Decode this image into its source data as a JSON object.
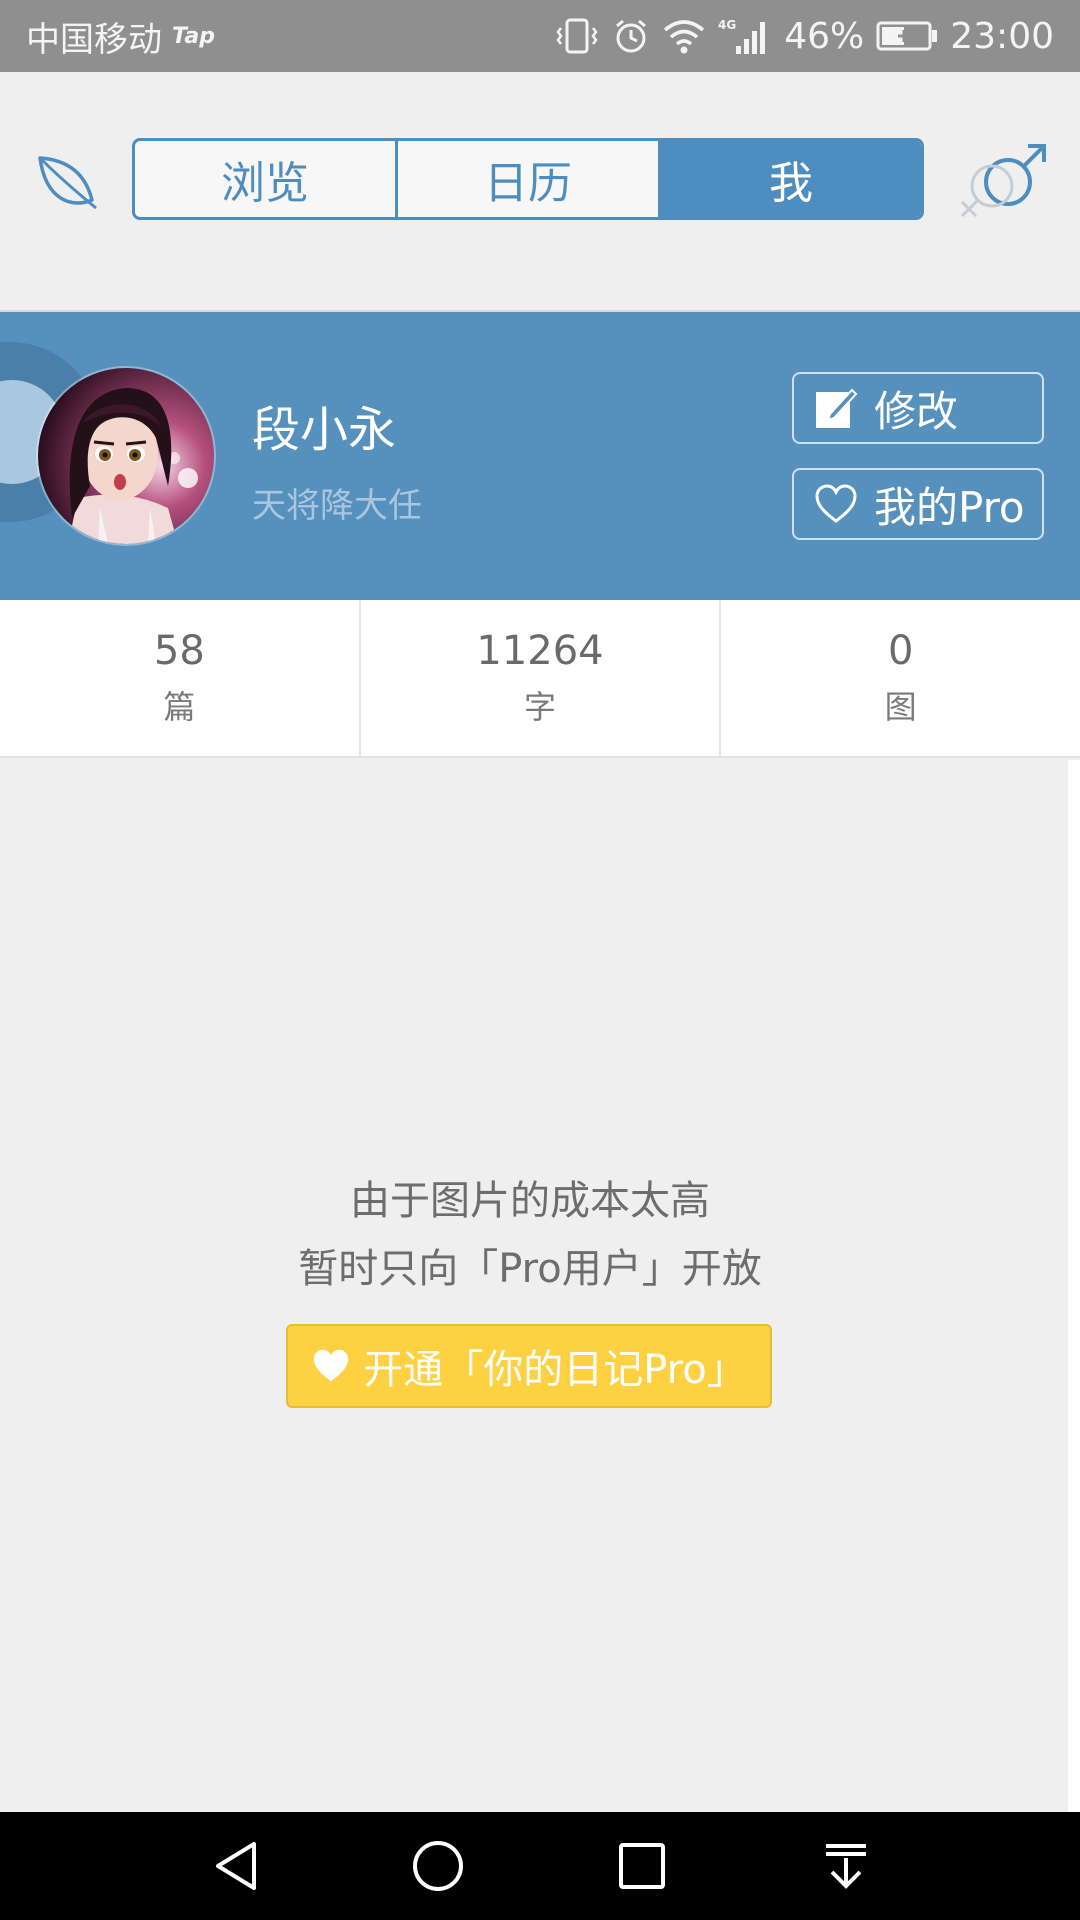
{
  "status_bar": {
    "carrier": "中国移动",
    "carrier_tag": "Tap",
    "network": "4G",
    "battery": "46%",
    "time": "23:00"
  },
  "header": {
    "tabs": [
      {
        "label": "浏览",
        "active": false
      },
      {
        "label": "日历",
        "active": false
      },
      {
        "label": "我",
        "active": true
      }
    ]
  },
  "profile": {
    "name": "段小永",
    "motto": "天将降大任",
    "edit_label": "修改",
    "pro_label": "我的Pro"
  },
  "stats": [
    {
      "value": "58",
      "label": "篇"
    },
    {
      "value": "11264",
      "label": "字"
    },
    {
      "value": "0",
      "label": "图"
    }
  ],
  "content": {
    "message_line1": "由于图片的成本太高",
    "message_line2": "暂时只向「Pro用户」开放",
    "cta_label": "开通「你的日记Pro」"
  },
  "colors": {
    "accent": "#4e8dbf",
    "profile_bg": "#5690bd",
    "cta": "#fdd142",
    "status_bar": "#8f8f8f",
    "nav_bar": "#000000"
  },
  "icons": {
    "app_logo": "leaf-icon",
    "gender": "gender-icon",
    "edit": "edit-icon",
    "pro": "heart-icon",
    "cta": "heart-icon",
    "nav": [
      "back-icon",
      "home-icon",
      "recents-icon",
      "notification-drawer-icon"
    ]
  }
}
